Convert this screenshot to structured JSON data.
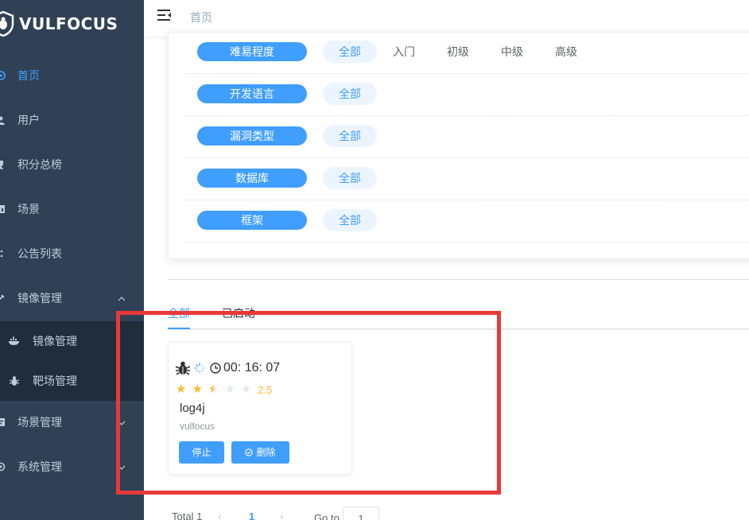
{
  "brand": {
    "name": "VULFOCUS"
  },
  "sidebar": {
    "items": [
      {
        "label": "首页",
        "icon": "home-icon",
        "active": true
      },
      {
        "label": "用户",
        "icon": "user-icon"
      },
      {
        "label": "积分总榜",
        "icon": "rank-icon"
      },
      {
        "label": "场景",
        "icon": "scene-icon"
      },
      {
        "label": "公告列表",
        "icon": "notice-icon"
      },
      {
        "label": "镜像管理",
        "icon": "image-icon",
        "expanded": true
      },
      {
        "label": "场景管理",
        "icon": "scene-manage-icon"
      },
      {
        "label": "系统管理",
        "icon": "system-icon"
      }
    ],
    "subitems": [
      {
        "label": "镜像管理",
        "icon": "docker-icon"
      },
      {
        "label": "靶场管理",
        "icon": "bug-icon"
      }
    ]
  },
  "header": {
    "breadcrumb": "首页"
  },
  "filters": [
    {
      "label": "难易程度",
      "options": [
        "全部",
        "入门",
        "初级",
        "中级",
        "高级"
      ],
      "selected": "全部"
    },
    {
      "label": "开发语言",
      "options": [
        "全部"
      ],
      "selected": "全部"
    },
    {
      "label": "漏洞类型",
      "options": [
        "全部"
      ],
      "selected": "全部"
    },
    {
      "label": "数据库",
      "options": [
        "全部"
      ],
      "selected": "全部"
    },
    {
      "label": "框架",
      "options": [
        "全部"
      ],
      "selected": "全部"
    }
  ],
  "tabs": [
    {
      "label": "全部",
      "active": true
    },
    {
      "label": "已启动",
      "active": false
    }
  ],
  "container": {
    "timer": "00: 16: 07",
    "rating": 2.5,
    "rating_text": "2.5",
    "name": "log4j",
    "provider": "vulfocus",
    "stop_label": "停止",
    "delete_label": "删除"
  },
  "pagination": {
    "total": "Total 1",
    "current": "1",
    "goto_label": "Go to",
    "goto_value": "1"
  },
  "colors": {
    "sidebar_bg": "#304156",
    "submenu_bg": "#1f2d3d",
    "accent": "#409eff",
    "star": "#f7ba2a",
    "annotation": "#e8393a"
  }
}
